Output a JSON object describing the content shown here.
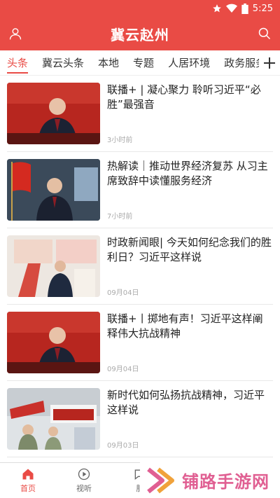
{
  "status_bar": {
    "time": "5:25"
  },
  "app_bar": {
    "title": "冀云赵州"
  },
  "tabs": [
    {
      "label": "头条"
    },
    {
      "label": "冀云头条"
    },
    {
      "label": "本地"
    },
    {
      "label": "专题"
    },
    {
      "label": "人居环境"
    },
    {
      "label": "政务服务"
    }
  ],
  "articles": [
    {
      "headline": "联播+ | 凝心聚力 聆听习近平“必胜”最强音",
      "time": "3小时前"
    },
    {
      "headline": "热解读｜推动世界经济复苏 从习主席致辞中读懂服务经济",
      "time": "7小时前"
    },
    {
      "headline": "时政新闻眼| 今天如何纪念我们的胜利日？习近平这样说",
      "time": "09月04日"
    },
    {
      "headline": "联播+丨掷地有声！习近平这样阐释伟大抗战精神",
      "time": "09月04日"
    },
    {
      "headline": "新时代如何弘扬抗战精神，习近平这样说",
      "time": "09月03日"
    }
  ],
  "bottom_nav": [
    {
      "label": "首页"
    },
    {
      "label": "视听"
    },
    {
      "label": "服"
    }
  ],
  "watermark": {
    "text": "铺路手游网"
  },
  "colors": {
    "brand": "#e94b45",
    "watermark": "#e05f92"
  }
}
